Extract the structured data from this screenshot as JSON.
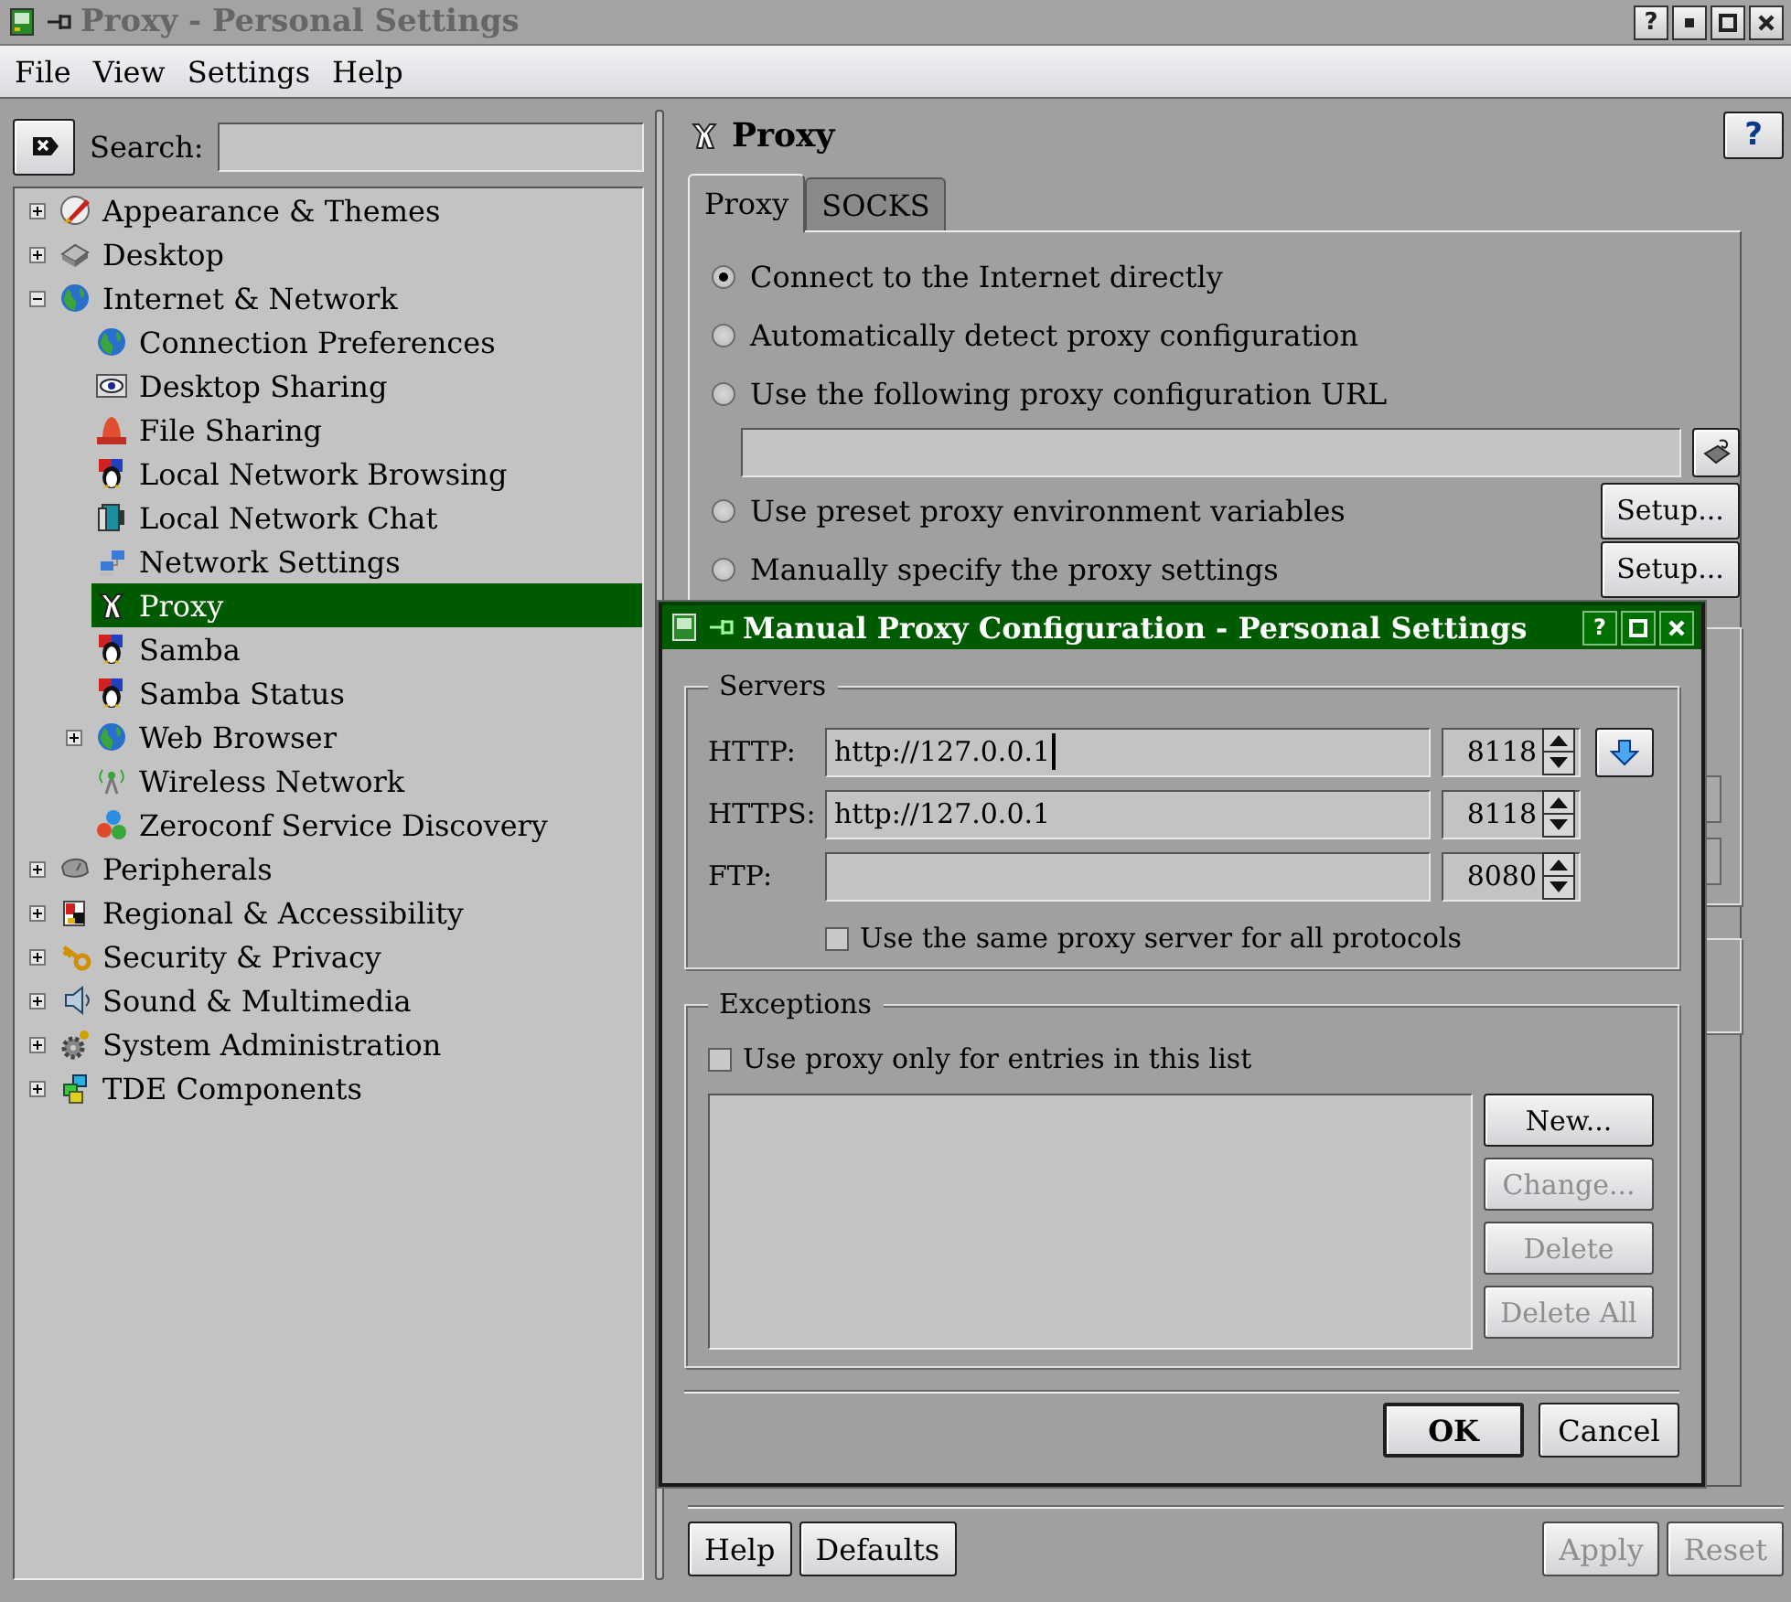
{
  "window": {
    "title": "Proxy - Personal Settings",
    "help_button": "?"
  },
  "menu": [
    "File",
    "View",
    "Settings",
    "Help"
  ],
  "search": {
    "label": "Search:"
  },
  "tree": [
    {
      "label": "Appearance & Themes",
      "expanded": false,
      "selected": false
    },
    {
      "label": "Desktop",
      "expanded": false,
      "selected": false
    },
    {
      "label": "Internet & Network",
      "expanded": true,
      "selected": false,
      "children": [
        {
          "label": "Connection Preferences",
          "selected": false
        },
        {
          "label": "Desktop Sharing",
          "selected": false
        },
        {
          "label": "File Sharing",
          "selected": false
        },
        {
          "label": "Local Network Browsing",
          "selected": false
        },
        {
          "label": "Local Network Chat",
          "selected": false
        },
        {
          "label": "Network Settings",
          "selected": false
        },
        {
          "label": "Proxy",
          "selected": true
        },
        {
          "label": "Samba",
          "selected": false
        },
        {
          "label": "Samba Status",
          "selected": false
        },
        {
          "label": "Web Browser",
          "expanded": false,
          "selected": false
        },
        {
          "label": "Wireless Network",
          "selected": false
        },
        {
          "label": "Zeroconf Service Discovery",
          "selected": false
        }
      ]
    },
    {
      "label": "Peripherals",
      "expanded": false,
      "selected": false
    },
    {
      "label": "Regional & Accessibility",
      "expanded": false,
      "selected": false
    },
    {
      "label": "Security & Privacy",
      "expanded": false,
      "selected": false
    },
    {
      "label": "Sound & Multimedia",
      "expanded": false,
      "selected": false
    },
    {
      "label": "System Administration",
      "expanded": false,
      "selected": false
    },
    {
      "label": "TDE Components",
      "expanded": false,
      "selected": false
    }
  ],
  "module": {
    "title": "Proxy",
    "help_button": "?",
    "tabs": [
      {
        "label": "Proxy",
        "selected": true
      },
      {
        "label": "SOCKS",
        "selected": false
      }
    ],
    "options": [
      {
        "kind": "radio",
        "label": "Connect to the Internet directly",
        "selected": true
      },
      {
        "kind": "radio",
        "label": "Automatically detect proxy configuration",
        "selected": false
      },
      {
        "kind": "radio",
        "label": "Use the following proxy configuration URL",
        "selected": false
      },
      {
        "kind": "url-field"
      },
      {
        "kind": "radio",
        "label": "Use preset proxy environment variables",
        "selected": false,
        "button": "Setup..."
      },
      {
        "kind": "radio",
        "label": "Manually specify the proxy settings",
        "selected": false,
        "button": "Setup..."
      }
    ],
    "footer": {
      "left": [
        {
          "label": "Help",
          "disabled": false
        },
        {
          "label": "Defaults",
          "disabled": false
        }
      ],
      "right": [
        {
          "label": "Apply",
          "disabled": true
        },
        {
          "label": "Reset",
          "disabled": true
        }
      ]
    }
  },
  "dialog": {
    "title": "Manual Proxy Configuration - Personal Settings",
    "help_button": "?",
    "servers": {
      "title": "Servers",
      "rows": [
        {
          "label": "HTTP:",
          "value": "http://127.0.0.1",
          "port": "8118",
          "focused": true,
          "copy_down": true
        },
        {
          "label": "HTTPS:",
          "value": "http://127.0.0.1",
          "port": "8118",
          "focused": false,
          "copy_down": false
        },
        {
          "label": "FTP:",
          "port": "8080",
          "focused": false,
          "copy_down": false
        }
      ],
      "same_proxy": {
        "label": "Use the same proxy server for all protocols",
        "checked": false
      }
    },
    "exceptions": {
      "title": "Exceptions",
      "only_listed": {
        "label": "Use proxy only for entries in this list",
        "checked": false
      },
      "buttons": [
        {
          "label": "New...",
          "disabled": false
        },
        {
          "label": "Change...",
          "disabled": true
        },
        {
          "label": "Delete",
          "disabled": true
        },
        {
          "label": "Delete All",
          "disabled": true
        }
      ]
    },
    "buttons": [
      {
        "label": "OK",
        "default": true
      },
      {
        "label": "Cancel",
        "default": false
      }
    ]
  }
}
